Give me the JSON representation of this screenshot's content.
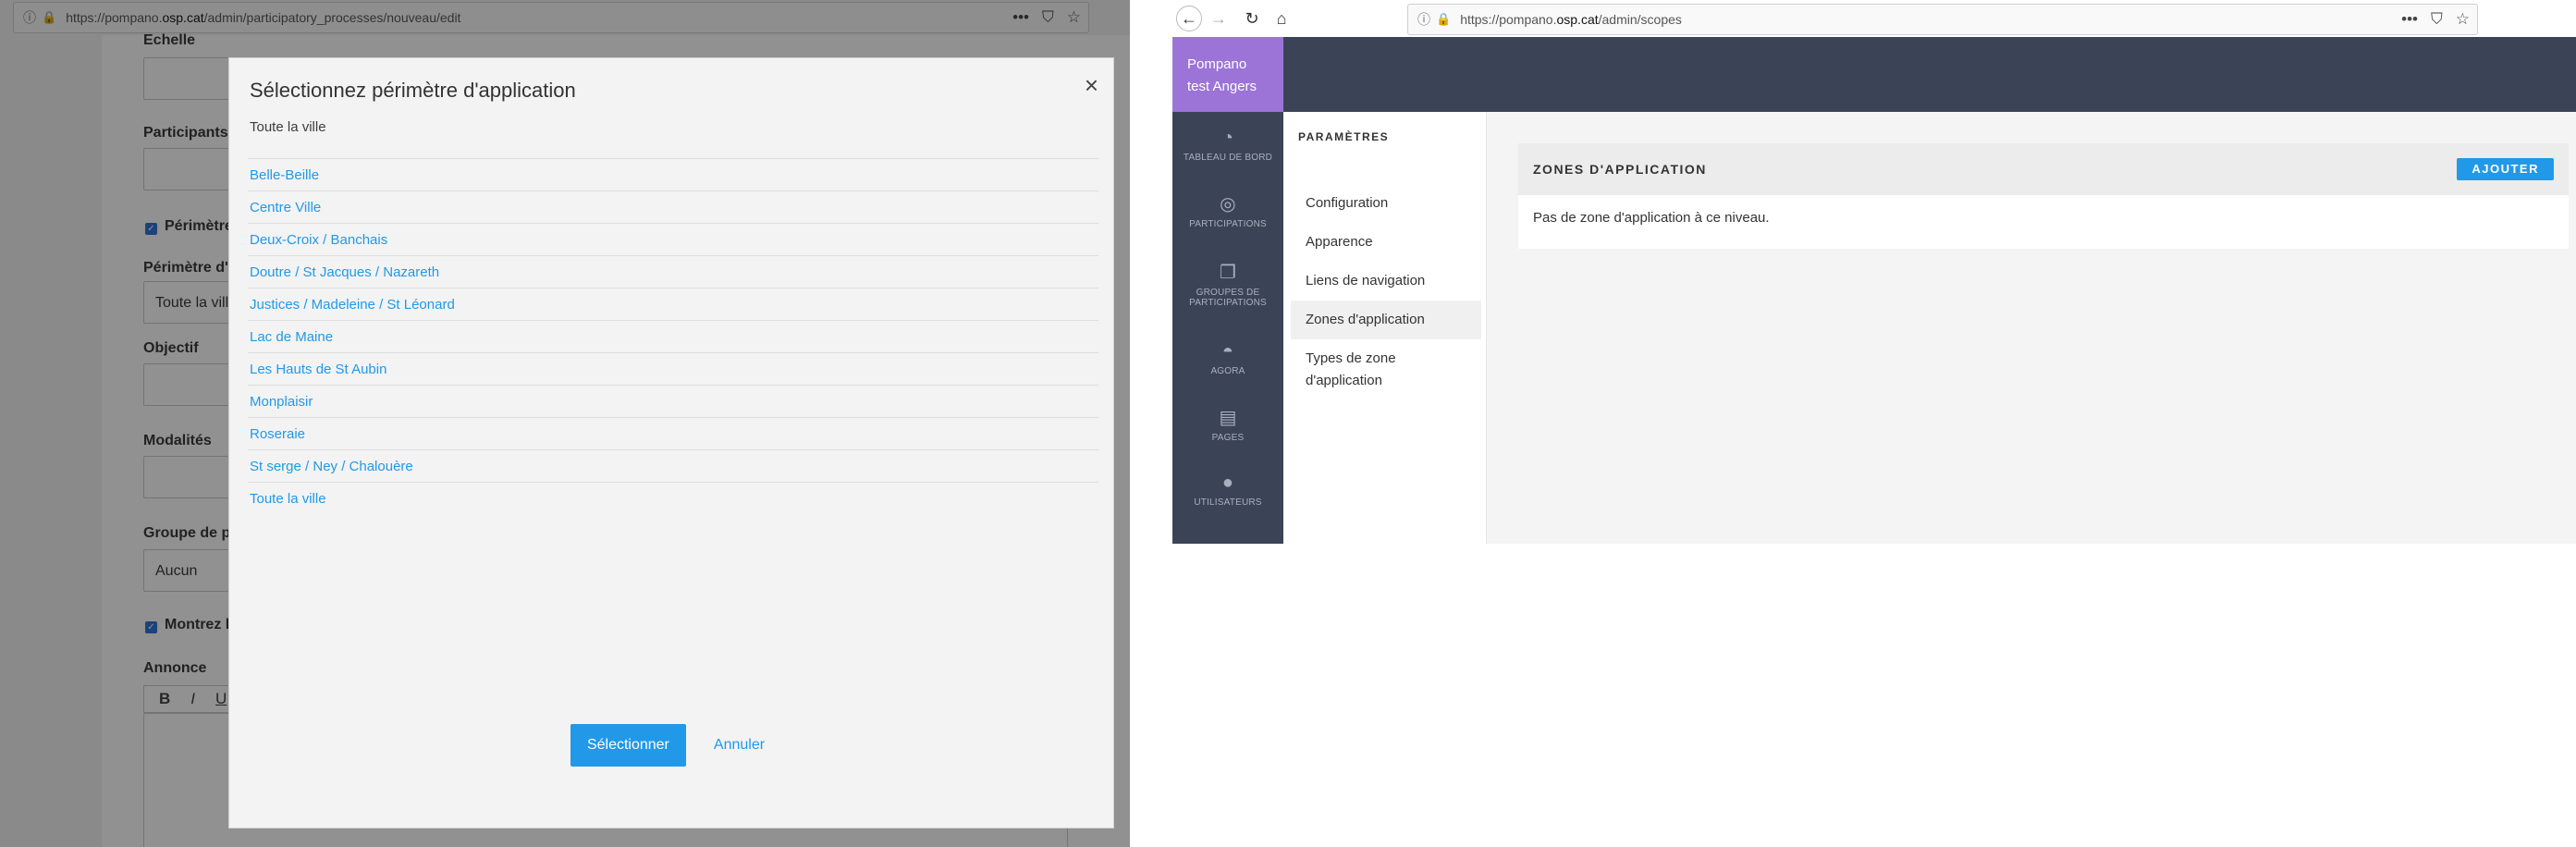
{
  "left_window": {
    "url": {
      "prefix": "https://pompano.",
      "host": "osp.cat",
      "path": "/admin/participatory_processes/nouveau/edit"
    },
    "form": {
      "labels": [
        "Echelle",
        "Participants",
        "Périmètre",
        "Périmètre d'a",
        "Objectif",
        "Modalités",
        "Groupe de pa",
        "Montrez le",
        "Annonce"
      ],
      "scope_value": "Toute la ville",
      "group_value": "Aucun",
      "editor_tools": [
        "B",
        "I",
        "U"
      ]
    },
    "modal": {
      "title": "Sélectionnez périmètre d'application",
      "selected": "Toute la ville",
      "options": [
        "Belle-Beille",
        "Centre Ville",
        "Deux-Croix / Banchais",
        "Doutre / St Jacques / Nazareth",
        "Justices / Madeleine / St Léonard",
        "Lac de Maine",
        "Les Hauts de St Aubin",
        "Monplaisir",
        "Roseraie",
        "St serge / Ney / Chalouère",
        "Toute la ville"
      ],
      "select_label": "Sélectionner",
      "cancel_label": "Annuler",
      "close_symbol": "×"
    }
  },
  "right_window": {
    "url": {
      "prefix": "https://pompano.",
      "host": "osp.cat",
      "path": "/admin/scopes"
    },
    "brand": {
      "line1": "Pompano",
      "line2": "test Angers"
    },
    "main_nav": [
      {
        "label": "TABLEAU DE BORD",
        "icon": "dashboard-icon"
      },
      {
        "label": "PARTICIPATIONS",
        "icon": "target-icon"
      },
      {
        "label": "GROUPES DE PARTICIPATIONS",
        "icon": "groups-icon"
      },
      {
        "label": "AGORA",
        "icon": "agora-icon"
      },
      {
        "label": "PAGES",
        "icon": "book-icon"
      },
      {
        "label": "UTILISATEURS",
        "icon": "user-icon"
      }
    ],
    "settings": {
      "title": "PARAMÈTRES",
      "items": [
        "Configuration",
        "Apparence",
        "Liens de navigation",
        "Zones d'application",
        "Types de zone d'application"
      ],
      "active_index": 3
    },
    "panel": {
      "title": "ZONES D'APPLICATION",
      "add_label": "AJOUTER",
      "empty_message": "Pas de zone d'application à ce niveau."
    }
  },
  "colors": {
    "link": "#2199e8",
    "brand": "#9c74d8",
    "nav_bg": "#3b4457"
  }
}
